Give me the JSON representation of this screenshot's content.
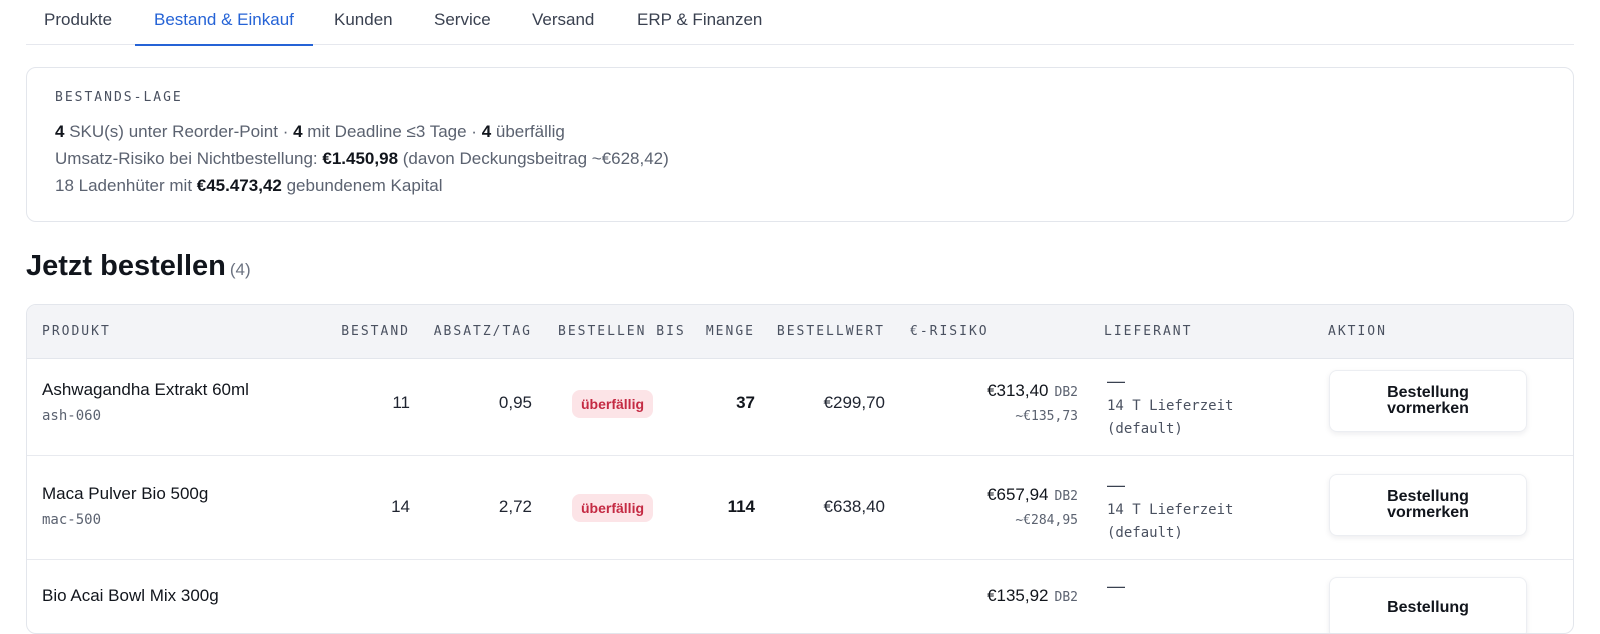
{
  "tabs": [
    {
      "label": "Produkte",
      "active": false
    },
    {
      "label": "Bestand & Einkauf",
      "active": true
    },
    {
      "label": "Kunden",
      "active": false
    },
    {
      "label": "Service",
      "active": false
    },
    {
      "label": "Versand",
      "active": false
    },
    {
      "label": "ERP & Finanzen",
      "active": false
    }
  ],
  "stock_summary": {
    "title": "BESTANDS-LAGE",
    "line1": {
      "sku_count": "4",
      "sku_text": " SKU(s) unter Reorder-Point · ",
      "deadline_count": "4",
      "deadline_text": " mit Deadline ≤3 Tage · ",
      "overdue_count": "4",
      "overdue_text": " überfällig"
    },
    "line2": {
      "prefix": "Umsatz-Risiko bei Nichtbestellung: ",
      "amount": "€1.450,98",
      "suffix": " (davon Deckungsbeitrag ~€628,42)"
    },
    "line3": {
      "prefix": "18 Ladenhüter mit ",
      "amount": "€45.473,42",
      "suffix": " gebundenem Kapital"
    }
  },
  "order_section": {
    "title": "Jetzt bestellen",
    "count": "(4)"
  },
  "table": {
    "headers": {
      "product": "PRODUKT",
      "stock": "BESTAND",
      "sales_per_day": "ABSATZ/TAG",
      "order_by": "BESTELLEN BIS",
      "quantity": "MENGE",
      "order_value": "BESTELLWERT",
      "risk": "€-RISIKO",
      "supplier": "LIEFERANT",
      "action": "AKTION"
    },
    "rows": [
      {
        "name": "Ashwagandha Extrakt 60ml",
        "sku": "ash-060",
        "stock": "11",
        "sales_per_day": "0,95",
        "order_by": "überfällig",
        "quantity": "37",
        "order_value": "€299,70",
        "risk": "€313,40",
        "risk_tag": "DB2",
        "risk_sub": "~€135,73",
        "supplier": "—",
        "supplier_note": "14 T Lieferzeit (default)",
        "action": "Bestellung vormerken"
      },
      {
        "name": "Maca Pulver Bio 500g",
        "sku": "mac-500",
        "stock": "14",
        "sales_per_day": "2,72",
        "order_by": "überfällig",
        "quantity": "114",
        "order_value": "€638,40",
        "risk": "€657,94",
        "risk_tag": "DB2",
        "risk_sub": "~€284,95",
        "supplier": "—",
        "supplier_note": "14 T Lieferzeit (default)",
        "action": "Bestellung vormerken"
      },
      {
        "name": "Bio Acai Bowl Mix 300g",
        "sku": "",
        "stock": "",
        "sales_per_day": "",
        "order_by": "",
        "quantity": "",
        "order_value": "",
        "risk": "€135,92",
        "risk_tag": "DB2",
        "risk_sub": "",
        "supplier": "—",
        "supplier_note": "",
        "action": "Bestellung"
      }
    ]
  },
  "colors": {
    "accent": "#2563d6",
    "overdue_bg": "#fce4e7",
    "overdue_text": "#c42a43"
  }
}
